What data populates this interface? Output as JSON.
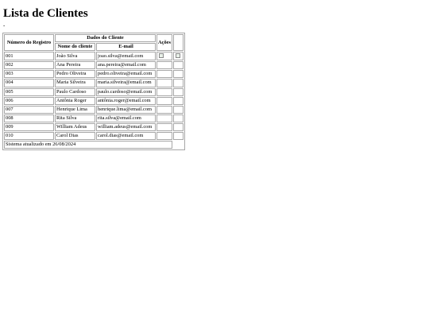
{
  "page": {
    "title": "Lista de Clientes",
    "stray_mark": "-"
  },
  "table": {
    "headers": {
      "registro": "Número do Registro",
      "dados": "Dados do Cliente",
      "nome": "Nome do cliente",
      "email": "E-mail",
      "acoes": "Ações"
    },
    "rows": [
      {
        "id": "001",
        "name": "João Silva",
        "email": "joao.silva@email.com"
      },
      {
        "id": "002",
        "name": "Ana Pereira",
        "email": "ana.pereira@email.com"
      },
      {
        "id": "003",
        "name": "Pedro Oliveira",
        "email": "pedro.oliveira@email.com"
      },
      {
        "id": "004",
        "name": "Maria Silveira",
        "email": "maria.silveira@email.com"
      },
      {
        "id": "005",
        "name": "Paulo Cardoso",
        "email": "paulo.cardoso@email.com"
      },
      {
        "id": "006",
        "name": "Antônia Roger",
        "email": "antônia.roger@email.com"
      },
      {
        "id": "007",
        "name": "Henrique Lima",
        "email": "henrique.lima@email.com"
      },
      {
        "id": "008",
        "name": "Rita Silva",
        "email": "rita.silva@email.com"
      },
      {
        "id": "009",
        "name": "William Adeus",
        "email": "william.adeus@email.com"
      },
      {
        "id": "010",
        "name": "Carol Dias",
        "email": "carol.dias@email.com"
      }
    ],
    "footer": "Sistema atualizado em 26/08/2024"
  }
}
